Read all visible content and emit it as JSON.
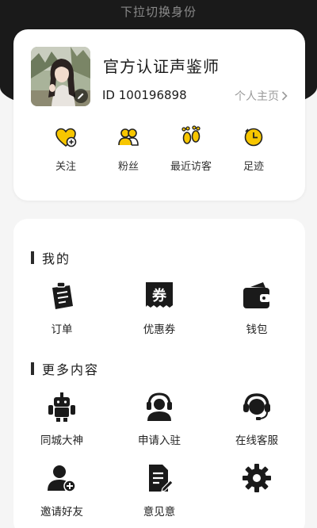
{
  "header": {
    "switch_hint": "下拉切换身份"
  },
  "profile": {
    "name": "官方认证声鉴师",
    "id_text": "ID 100196898",
    "homepage_label": "个人主页"
  },
  "quick_actions": [
    {
      "label": "关注",
      "icon": "heart-plus-icon"
    },
    {
      "label": "粉丝",
      "icon": "users-icon"
    },
    {
      "label": "最近访客",
      "icon": "footprints-icon"
    },
    {
      "label": "足迹",
      "icon": "clock-icon"
    }
  ],
  "sections": {
    "mine": {
      "title": "我的",
      "items": [
        {
          "label": "订单",
          "icon": "order-clipboard-icon"
        },
        {
          "label": "优惠券",
          "icon": "coupon-icon"
        },
        {
          "label": "钱包",
          "icon": "wallet-icon"
        }
      ]
    },
    "more": {
      "title": "更多内容",
      "items": [
        {
          "label": "同城大神",
          "icon": "robot-icon"
        },
        {
          "label": "申请入驻",
          "icon": "headset-user-icon"
        },
        {
          "label": "在线客服",
          "icon": "customer-service-icon"
        },
        {
          "label": "邀请好友",
          "icon": "add-user-icon"
        },
        {
          "label": "意见意",
          "icon": "feedback-doc-icon"
        },
        {
          "label": "",
          "icon": "gear-icon"
        }
      ]
    }
  },
  "colors": {
    "accent_yellow": "#f7c600",
    "dark_header": "#1a1a1a",
    "card_bg": "#ffffff"
  }
}
